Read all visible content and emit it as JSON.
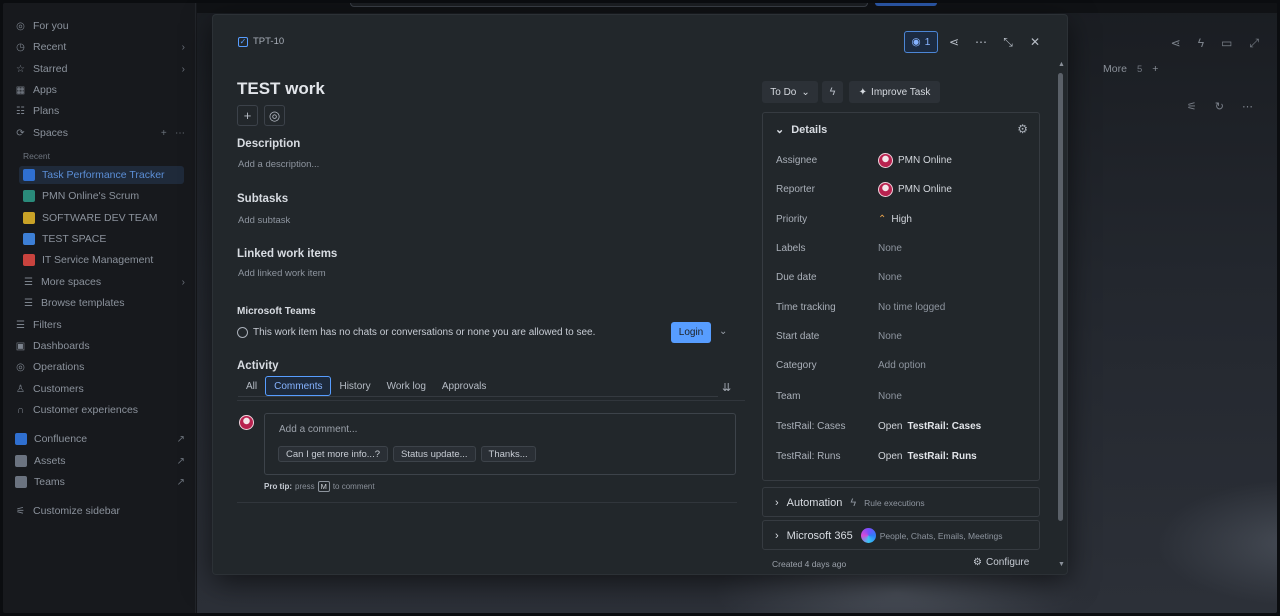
{
  "sidebar": {
    "items": [
      {
        "label": "For you",
        "icon": "circle-user-icon"
      },
      {
        "label": "Recent",
        "icon": "clock-icon"
      },
      {
        "label": "Starred",
        "icon": "star-icon"
      },
      {
        "label": "Apps",
        "icon": "apps-icon"
      },
      {
        "label": "Plans",
        "icon": "plans-icon"
      },
      {
        "label": "Spaces",
        "icon": "spaces-icon"
      }
    ],
    "recent_caption": "Recent",
    "spaces": [
      {
        "label": "Task Performance Tracker",
        "color": "#2f6fd0"
      },
      {
        "label": "PMN Online's Scrum",
        "color": "#2a8a7a"
      },
      {
        "label": "SOFTWARE DEV TEAM",
        "color": "#c9a227"
      },
      {
        "label": "TEST SPACE",
        "color": "#3d7fd6"
      },
      {
        "label": "IT Service Management",
        "color": "#c9433e"
      }
    ],
    "more_spaces": "More spaces",
    "browse_templates": "Browse templates",
    "lower": [
      {
        "label": "Filters",
        "icon": "filter-icon"
      },
      {
        "label": "Dashboards",
        "icon": "dashboard-icon"
      },
      {
        "label": "Operations",
        "icon": "operations-icon"
      },
      {
        "label": "Customers",
        "icon": "customers-icon"
      },
      {
        "label": "Customer experiences",
        "icon": "headset-icon"
      }
    ],
    "apps": [
      {
        "label": "Confluence",
        "color": "#2f6fd0"
      },
      {
        "label": "Assets",
        "color": "#6b7380"
      },
      {
        "label": "Teams",
        "color": "#6b7380"
      }
    ],
    "customize": "Customize sidebar"
  },
  "background": {
    "more_label": "More",
    "more_count": "5"
  },
  "modal": {
    "issue_key": "TPT-10",
    "watch_count": "1",
    "title": "TEST work",
    "description_heading": "Description",
    "description_placeholder": "Add a description...",
    "subtasks_heading": "Subtasks",
    "subtasks_action": "Add subtask",
    "linked_heading": "Linked work items",
    "linked_action": "Add linked work item",
    "teams_heading": "Microsoft Teams",
    "teams_message": "This work item has no chats or conversations or none you are allowed to see.",
    "login_label": "Login",
    "activity_heading": "Activity",
    "activity_tabs": [
      "All",
      "Comments",
      "History",
      "Work log",
      "Approvals"
    ],
    "active_tab": "Comments",
    "comment_placeholder": "Add a comment...",
    "quick_replies": [
      "Can I get more info...?",
      "Status update...",
      "Thanks..."
    ],
    "protip_label": "Pro tip:",
    "protip_text": "press",
    "protip_key": "M",
    "protip_suffix": "to comment",
    "status": "To Do",
    "improve_label": "Improve Task",
    "details_heading": "Details",
    "details": [
      {
        "label": "Assignee",
        "value": "PMN Online",
        "avatar": true
      },
      {
        "label": "Reporter",
        "value": "PMN Online",
        "avatar": true
      },
      {
        "label": "Priority",
        "value": "High",
        "icon": "chevron-up-icon"
      },
      {
        "label": "Labels",
        "value": "None"
      },
      {
        "label": "Due date",
        "value": "None"
      },
      {
        "label": "Time tracking",
        "value": "No time logged"
      },
      {
        "label": "Start date",
        "value": "None"
      },
      {
        "label": "Category",
        "value": "Add option"
      },
      {
        "label": "Team",
        "value": "None"
      },
      {
        "label": "TestRail: Cases",
        "prefix": "Open",
        "value": "TestRail: Cases"
      },
      {
        "label": "TestRail: Runs",
        "prefix": "Open",
        "value": "TestRail: Runs"
      }
    ],
    "automation_label": "Automation",
    "automation_sub": "Rule executions",
    "m365_label": "Microsoft 365",
    "m365_sub": "People, Chats, Emails, Meetings",
    "created": "Created 4 days ago",
    "configure_label": "Configure"
  }
}
